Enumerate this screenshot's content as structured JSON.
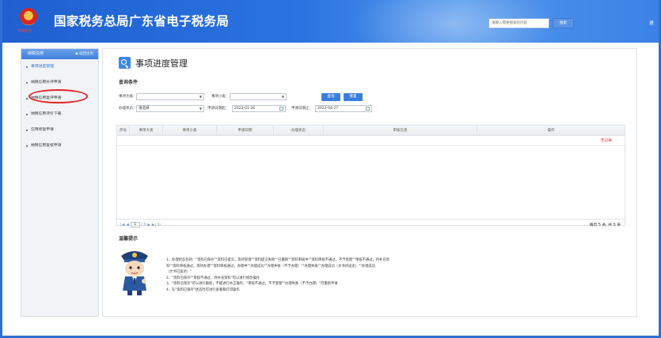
{
  "header": {
    "emblem_text": "中国税务",
    "title": "国家税务总局广东省电子税务局",
    "search_placeholder": "请输入需要搜索的内容",
    "search_button": "搜索",
    "edge_text": "退"
  },
  "sidebar": {
    "heading": "纳税信用",
    "back_label": "◆ 返回主页",
    "items": [
      {
        "label": "事项进度管理",
        "active": true
      },
      {
        "label": "纳税信用补评申请",
        "active": false
      },
      {
        "label": "纳税信用复评申请",
        "active": false
      },
      {
        "label": "纳税信用评价下载",
        "active": false
      },
      {
        "label": "信用修复申请",
        "active": false
      },
      {
        "label": "纳税信用复核申请",
        "active": false
      }
    ]
  },
  "main": {
    "title": "事项进度管理",
    "query_heading": "查询条件",
    "filters": {
      "category_label": "事项大类：",
      "category_value": "",
      "subcategory_label": "事项小类：",
      "subcategory_value": "",
      "status_label": "办理状态：",
      "status_value": "请选择",
      "apply_from_label": "申请日期起：",
      "apply_from_value": "2022-01-26",
      "apply_to_label": "申请日期止：",
      "apply_to_value": "2022-04-27",
      "query_button": "查询",
      "reset_button": "重置"
    },
    "table": {
      "columns": [
        "序号",
        "事项大类",
        "事项小类",
        "申请日期",
        "办理状态",
        "审核信息",
        "操作"
      ],
      "no_record": "无记录"
    },
    "pager": {
      "nav_first": "|◀",
      "nav_prev": "◀",
      "page_value": "1",
      "page_total": "/ 0",
      "nav_next": "▶",
      "nav_last": "▶|",
      "refresh": "↻",
      "summary": "每页 5 条, 共 0 条"
    },
    "tips": {
      "heading": "温馨提示",
      "lines": [
        "1、办理状态包括：\"资料已保存\"\"资料已提交，等待受理\"\"资料提交失败\"\"已撤销\"\"资料审核中\"\"资料审核不通过，不予受理\"\"审核不通过，待补充资",
        "料\"\"资料审核通过，等待办理\"\"资料审核通过，办理中\"\"办理成功\"\"办理失败（不予办理）\"\"办理失败\"\"办理成功（文书待送达）\"\"办理成功",
        "（文书已送达）\"",
        "2、\"资料已保存\"\"审核不通过，待补充资料\"可以进行修改操作",
        "3、\"资料已保存\"可以进行删除，不能进行补正操作；\"审核不通过，不予受理\"\"办理失败（不予办理）\"可重新申请",
        "4、在\"资料已保存\"状态时可进行查看和打印操作"
      ]
    }
  },
  "colors": {
    "accent": "#2f6fd3",
    "no_record": "#e0262a",
    "circle_mark": "#e0262a"
  }
}
